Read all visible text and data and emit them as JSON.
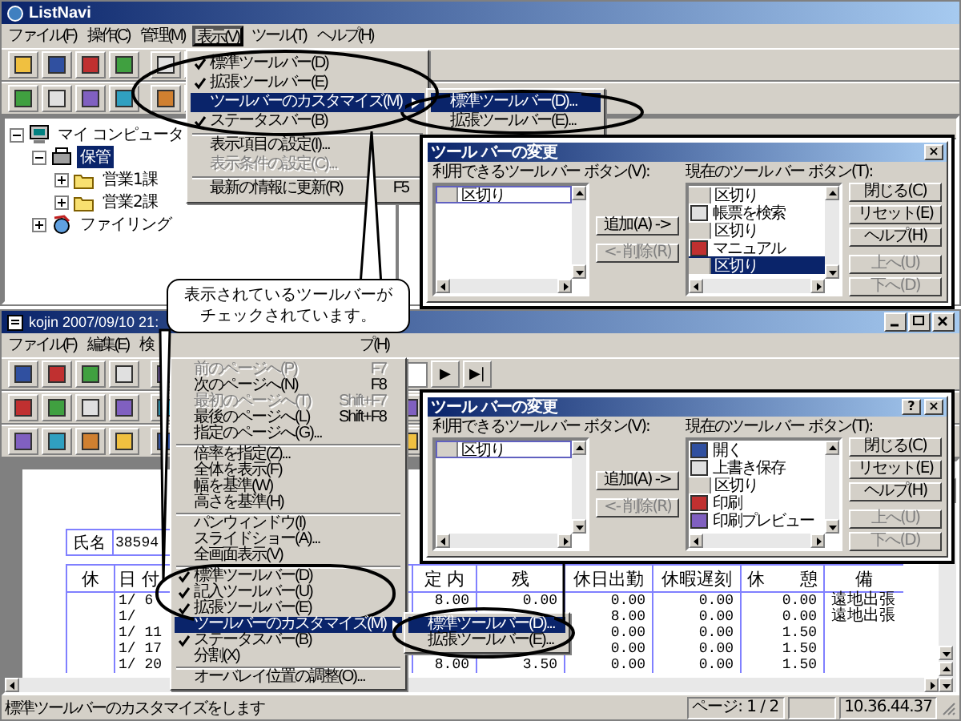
{
  "top_window": {
    "title": "ListNavi",
    "menu": [
      {
        "label": "ファイル(F)",
        "selected": false
      },
      {
        "label": "操作(C)",
        "selected": false
      },
      {
        "label": "管理(M)",
        "selected": false
      },
      {
        "label": "表示(V)",
        "selected": true
      },
      {
        "label": "ツール(T)",
        "selected": false
      },
      {
        "label": "ヘルプ(H)",
        "selected": false
      }
    ],
    "tree": [
      {
        "label": "マイ コンピュータ",
        "kind": "computer",
        "expanded": true,
        "selected": false,
        "children": [
          {
            "label": "保管",
            "kind": "cabinet",
            "expanded": true,
            "selected": true,
            "children": [
              {
                "label": "営業1課",
                "kind": "folder",
                "expanded": false,
                "selected": false
              },
              {
                "label": "営業2課",
                "kind": "folder",
                "expanded": false,
                "selected": false
              }
            ]
          },
          {
            "label": "ファイリング",
            "kind": "filing",
            "expanded": false,
            "selected": false
          }
        ]
      }
    ]
  },
  "view_menu": {
    "items": [
      {
        "kind": "item",
        "label": "標準ツールバー(D)",
        "checked": true,
        "selected": false,
        "disabled": false
      },
      {
        "kind": "item",
        "label": "拡張ツールバー(E)",
        "checked": true,
        "selected": false,
        "disabled": false
      },
      {
        "kind": "submenu",
        "label": "ツールバーのカスタマイズ(M)",
        "checked": false,
        "selected": true,
        "disabled": false
      },
      {
        "kind": "item",
        "label": "ステータスバー(B)",
        "checked": true,
        "selected": false,
        "disabled": false
      },
      {
        "kind": "separator"
      },
      {
        "kind": "item",
        "label": "表示項目の設定(I)...",
        "checked": false,
        "selected": false,
        "disabled": false
      },
      {
        "kind": "item",
        "label": "表示条件の設定(C)...",
        "checked": false,
        "selected": false,
        "disabled": true
      },
      {
        "kind": "separator"
      },
      {
        "kind": "item",
        "label": "最新の情報に更新(R)",
        "shortcut": "F5",
        "checked": false,
        "selected": false,
        "disabled": false
      }
    ]
  },
  "view_submenu": {
    "items": [
      {
        "kind": "item",
        "label": "標準ツールバー(D)...",
        "checked": false,
        "selected": true,
        "disabled": false
      },
      {
        "kind": "item",
        "label": "拡張ツールバー(E)...",
        "checked": false,
        "selected": false,
        "disabled": false
      }
    ]
  },
  "top_dialog": {
    "title": "ツール バーの変更",
    "title_buttons": [
      "×"
    ],
    "available_label": "利用できるツール バー ボタン(V):",
    "available_items": [
      {
        "label": "区切り",
        "kind": "separator",
        "selected": false,
        "focused": true
      }
    ],
    "add_button": {
      "label": "追加(A) ->",
      "disabled": false
    },
    "remove_button": {
      "label": "<- 削除(R)",
      "disabled": true
    },
    "current_label": "現在のツール バー ボタン(T):",
    "current_items": [
      {
        "label": "区切り",
        "kind": "separator",
        "selected": false,
        "focused": false
      },
      {
        "label": "帳票を検索",
        "kind": "icon",
        "selected": false,
        "focused": false
      },
      {
        "label": "区切り",
        "kind": "separator",
        "selected": false,
        "focused": false
      },
      {
        "label": "マニュアル",
        "kind": "icon",
        "selected": false,
        "focused": false
      },
      {
        "label": "区切り",
        "kind": "separator",
        "selected": true,
        "focused": false
      }
    ],
    "buttons": [
      {
        "label": "閉じる(C)",
        "disabled": false
      },
      {
        "label": "リセット(E)",
        "disabled": false
      },
      {
        "label": "ヘルプ(H)",
        "disabled": false
      },
      {
        "label": "上へ(U)",
        "disabled": true
      },
      {
        "label": "下へ(D)",
        "disabled": true
      }
    ]
  },
  "callout": {
    "lines": [
      "表示されているツールバーが",
      "チェックされています。"
    ]
  },
  "bottom_window": {
    "title": "kojin 2007/09/10 21:",
    "menu": [
      {
        "label": "ファイル(F)",
        "selected": false
      },
      {
        "label": "編集(E)",
        "selected": false
      },
      {
        "label": "検",
        "selected": false
      },
      {
        "label": "プ(H)",
        "selected": false
      }
    ],
    "nav_buttons": [
      "▶",
      "▶|"
    ],
    "name_label": "氏名",
    "name_value": "38594",
    "columns": [
      "休",
      "日 付",
      "定 内",
      "残",
      "休日出勤",
      "休暇遅刻",
      "休　　憩",
      "備"
    ],
    "rows": [
      {
        "date": "1/ 6",
        "fixed": "8.00",
        "overtime": "0.00",
        "holiday_work": "0.00",
        "leave_late": "0.00",
        "break": "0.00",
        "note": "遠地出張"
      },
      {
        "date": "1/",
        "holiday_work": "8.00",
        "leave_late": "0.00",
        "break": "0.00",
        "note": "遠地出張"
      },
      {
        "date": "1/ 11",
        "holiday_work": "0.00",
        "leave_late": "0.00",
        "break": "1.50"
      },
      {
        "date": "1/ 17",
        "holiday_work": "0.00",
        "leave_late": "0.00",
        "break": "1.50"
      },
      {
        "date": "1/ 20",
        "fixed": "8.00",
        "overtime": "3.50",
        "holiday_work": "0.00",
        "leave_late": "0.00",
        "break": "1.50"
      }
    ],
    "status_text": "標準ツールバーのカスタマイズをします",
    "page_status": "ページ: 1 / 2",
    "time_status": "10.36.44.37"
  },
  "bottom_menu": {
    "items": [
      {
        "kind": "item",
        "label": "前のページへ(P)",
        "shortcut": "F7",
        "checked": false,
        "selected": false,
        "disabled": true
      },
      {
        "kind": "item",
        "label": "次のページへ(N)",
        "shortcut": "F8",
        "checked": false,
        "selected": false,
        "disabled": false
      },
      {
        "kind": "item",
        "label": "最初のページへ(T)",
        "shortcut": "Shift+F7",
        "checked": false,
        "selected": false,
        "disabled": true
      },
      {
        "kind": "item",
        "label": "最後のページへ(L)",
        "shortcut": "Shift+F8",
        "checked": false,
        "selected": false,
        "disabled": false
      },
      {
        "kind": "item",
        "label": "指定のページへ(G)...",
        "checked": false,
        "selected": false,
        "disabled": false
      },
      {
        "kind": "separator"
      },
      {
        "kind": "item",
        "label": "倍率を指定(Z)...",
        "checked": false,
        "selected": false,
        "disabled": false
      },
      {
        "kind": "item",
        "label": "全体を表示(F)",
        "checked": false,
        "selected": false,
        "disabled": false
      },
      {
        "kind": "item",
        "label": "幅を基準(W)",
        "checked": false,
        "selected": false,
        "disabled": false
      },
      {
        "kind": "item",
        "label": "高さを基準(H)",
        "checked": false,
        "selected": false,
        "disabled": false
      },
      {
        "kind": "separator"
      },
      {
        "kind": "item",
        "label": "パンウィンドウ(I)",
        "checked": false,
        "selected": false,
        "disabled": false
      },
      {
        "kind": "item",
        "label": "スライドショー(A)...",
        "checked": false,
        "selected": false,
        "disabled": false
      },
      {
        "kind": "item",
        "label": "全画面表示(V)",
        "checked": false,
        "selected": false,
        "disabled": false
      },
      {
        "kind": "separator"
      },
      {
        "kind": "item",
        "label": "標準ツールバー(D)",
        "checked": true,
        "selected": false,
        "disabled": false
      },
      {
        "kind": "item",
        "label": "記入ツールバー(U)",
        "checked": true,
        "selected": false,
        "disabled": false
      },
      {
        "kind": "item",
        "label": "拡張ツールバー(E)",
        "checked": true,
        "selected": false,
        "disabled": false
      },
      {
        "kind": "submenu",
        "label": "ツールバーのカスタマイズ(M)",
        "checked": false,
        "selected": true,
        "disabled": false
      },
      {
        "kind": "item",
        "label": "ステータスバー(B)",
        "checked": true,
        "selected": false,
        "disabled": false
      },
      {
        "kind": "item",
        "label": "分割(X)",
        "checked": false,
        "selected": false,
        "disabled": false
      },
      {
        "kind": "separator"
      },
      {
        "kind": "item",
        "label": "オーバレイ位置の調整(O)...",
        "checked": false,
        "selected": false,
        "disabled": false
      }
    ]
  },
  "bottom_submenu": {
    "items": [
      {
        "kind": "item",
        "label": "標準ツールバー(D)...",
        "checked": false,
        "selected": true,
        "disabled": false
      },
      {
        "kind": "item",
        "label": "拡張ツールバー(E)...",
        "checked": false,
        "selected": false,
        "disabled": false
      }
    ]
  },
  "bottom_dialog": {
    "title": "ツール バーの変更",
    "title_buttons": [
      "?",
      "×"
    ],
    "available_label": "利用できるツール バー ボタン(V):",
    "available_items": [
      {
        "label": "区切り",
        "kind": "separator",
        "selected": false,
        "focused": true
      }
    ],
    "add_button": {
      "label": "追加(A) ->",
      "disabled": false
    },
    "remove_button": {
      "label": "<- 削除(R)",
      "disabled": true
    },
    "current_label": "現在のツール バー ボタン(T):",
    "current_items": [
      {
        "label": "開く",
        "kind": "icon",
        "selected": false,
        "focused": false
      },
      {
        "label": "上書き保存",
        "kind": "icon",
        "selected": false,
        "focused": false
      },
      {
        "label": "区切り",
        "kind": "separator",
        "selected": false,
        "focused": false
      },
      {
        "label": "印刷",
        "kind": "icon",
        "selected": false,
        "focused": false
      },
      {
        "label": "印刷プレビュー",
        "kind": "icon",
        "selected": false,
        "focused": false
      }
    ],
    "buttons": [
      {
        "label": "閉じる(C)",
        "disabled": false
      },
      {
        "label": "リセット(E)",
        "disabled": false
      },
      {
        "label": "ヘルプ(H)",
        "disabled": false
      },
      {
        "label": "上へ(U)",
        "disabled": true
      },
      {
        "label": "下へ(D)",
        "disabled": true
      }
    ]
  }
}
